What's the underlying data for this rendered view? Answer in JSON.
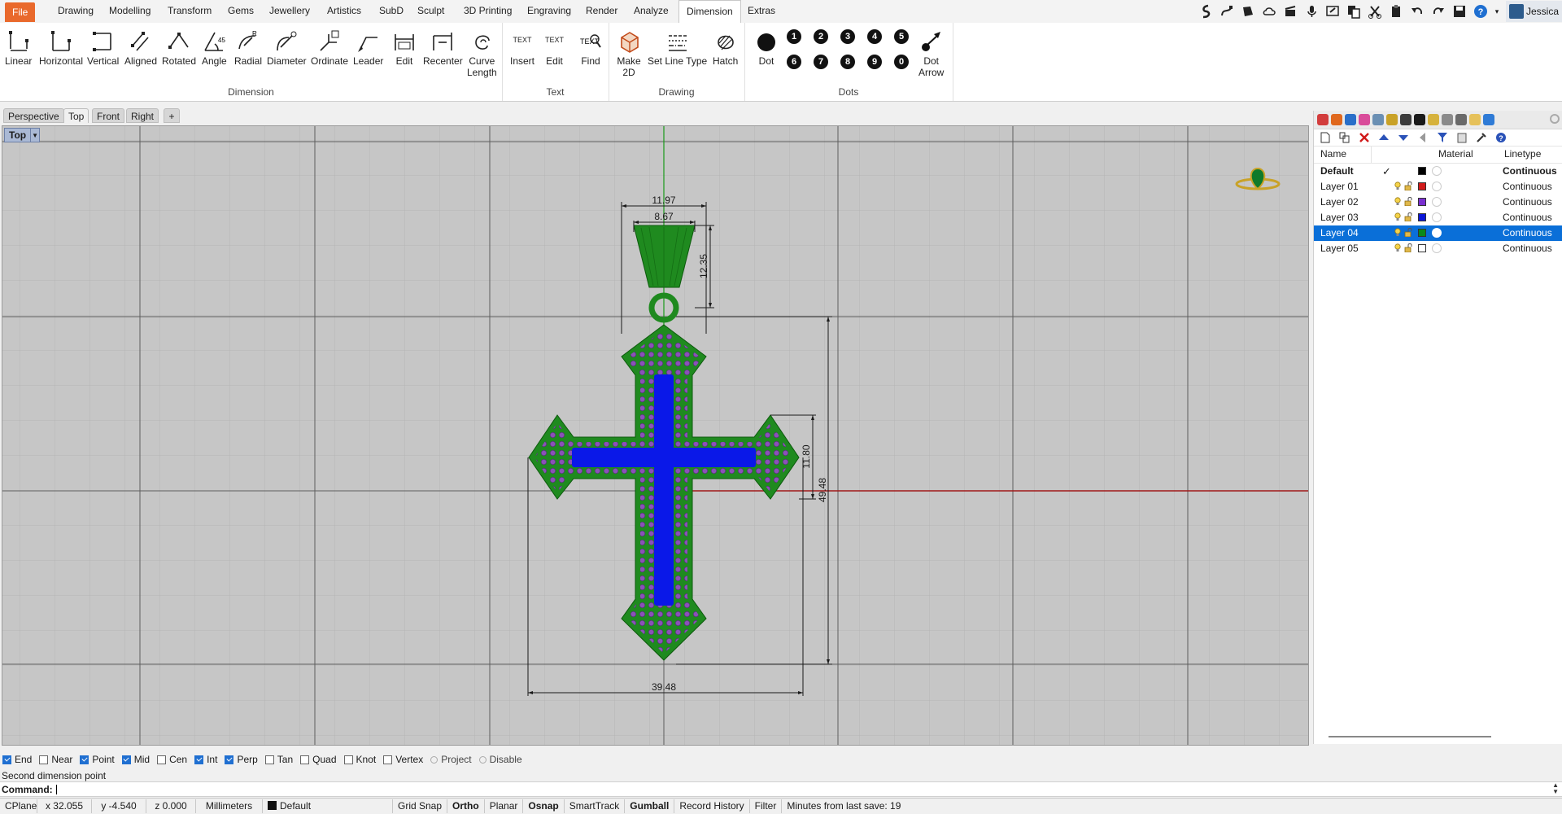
{
  "ribbon_tabs": [
    "File",
    "Drawing",
    "Modelling",
    "Transform",
    "Gems",
    "Jewellery",
    "Artistics",
    "SubD",
    "Sculpt",
    "3D Printing",
    "Engraving",
    "Render",
    "Analyze",
    "Dimension",
    "Extras"
  ],
  "user_name": "Jessica",
  "groups": {
    "dimension": {
      "title": "Dimension",
      "buttons": [
        "Linear",
        "Horizontal",
        "Vertical",
        "Aligned",
        "Rotated",
        "Angle",
        "Radial",
        "Diameter",
        "Ordinate",
        "Leader",
        "Edit",
        "Recenter"
      ],
      "curve_length": [
        "Curve",
        "Length"
      ]
    },
    "text": {
      "title": "Text",
      "buttons": [
        "Insert",
        "Edit",
        "Find"
      ],
      "glyph": "TEXT"
    },
    "drawing": {
      "title": "Drawing",
      "make2d": [
        "Make",
        "2D"
      ],
      "set_line_type": "Set Line Type",
      "hatch": "Hatch"
    },
    "dots": {
      "title": "Dots",
      "dot": "Dot",
      "numbers_top": [
        "1",
        "2",
        "3",
        "4",
        "5"
      ],
      "numbers_bottom": [
        "6",
        "7",
        "8",
        "9",
        "0"
      ],
      "dot_arrow": [
        "Dot",
        "Arrow"
      ]
    }
  },
  "viewport_tabs": [
    "Perspective",
    "Top",
    "Front",
    "Right",
    "+"
  ],
  "active_viewport": "Top",
  "dimensions": {
    "width_top": "11.97",
    "width_inner": "8.67",
    "bail_height": "12.35",
    "arm_height": "11.80",
    "total_height": "49.48",
    "total_width": "39.48"
  },
  "layers": {
    "headers": {
      "name": "Name",
      "material": "Material",
      "linetype": "Linetype"
    },
    "rows": [
      {
        "name": "Default",
        "color": "#000000",
        "linetype": "Continuous",
        "current": true,
        "selected": false
      },
      {
        "name": "Layer 01",
        "color": "#d11a1a",
        "linetype": "Continuous",
        "current": false,
        "selected": false
      },
      {
        "name": "Layer 02",
        "color": "#7a2fd0",
        "linetype": "Continuous",
        "current": false,
        "selected": false
      },
      {
        "name": "Layer 03",
        "color": "#0a16d8",
        "linetype": "Continuous",
        "current": false,
        "selected": false
      },
      {
        "name": "Layer 04",
        "color": "#0a8a1a",
        "linetype": "Continuous",
        "current": false,
        "selected": true
      },
      {
        "name": "Layer 05",
        "color": "#ffffff",
        "linetype": "Continuous",
        "current": false,
        "selected": false
      }
    ]
  },
  "osnaps": [
    {
      "label": "End",
      "on": true
    },
    {
      "label": "Near",
      "on": false
    },
    {
      "label": "Point",
      "on": true
    },
    {
      "label": "Mid",
      "on": true
    },
    {
      "label": "Cen",
      "on": false
    },
    {
      "label": "Int",
      "on": true
    },
    {
      "label": "Perp",
      "on": true
    },
    {
      "label": "Tan",
      "on": false
    },
    {
      "label": "Quad",
      "on": false
    },
    {
      "label": "Knot",
      "on": false
    },
    {
      "label": "Vertex",
      "on": false
    }
  ],
  "osnap_extra": [
    "Project",
    "Disable"
  ],
  "command_history": "Second dimension point",
  "command_label": "Command:",
  "status": {
    "cplane": "CPlane",
    "x": "x 32.055",
    "y": "y -4.540",
    "z": "z 0.000",
    "units": "Millimeters",
    "layer": "Default",
    "toggles": [
      {
        "label": "Grid Snap",
        "bold": false
      },
      {
        "label": "Ortho",
        "bold": true
      },
      {
        "label": "Planar",
        "bold": false
      },
      {
        "label": "Osnap",
        "bold": true
      },
      {
        "label": "SmartTrack",
        "bold": false
      },
      {
        "label": "Gumball",
        "bold": true
      },
      {
        "label": "Record History",
        "bold": false
      },
      {
        "label": "Filter",
        "bold": false
      }
    ],
    "save_info": "Minutes from last save: 19"
  },
  "colors": {
    "accent": "#0a6fd8",
    "file_tab": "#e9692c",
    "pendant_green": "#1f8a1f",
    "inlay_blue": "#0a18e8",
    "gem_purple": "#7a4aa8"
  }
}
